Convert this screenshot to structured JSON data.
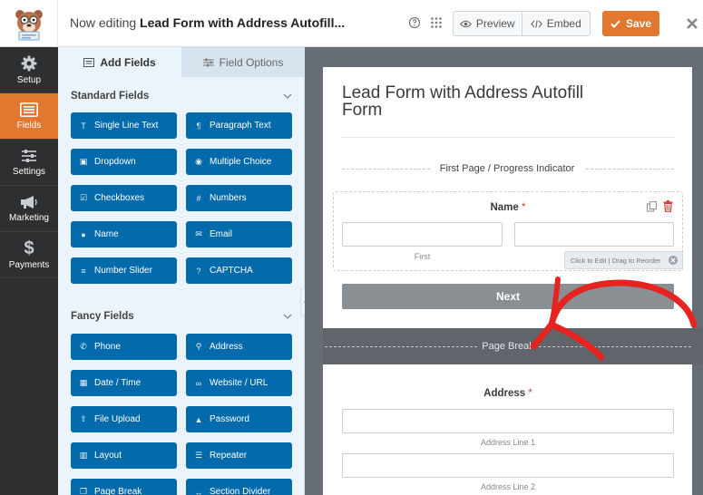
{
  "header": {
    "editing_prefix": "Now editing ",
    "editing_form_name": "Lead Form with Address Autofill...",
    "preview_label": "Preview",
    "embed_label": "Embed",
    "save_label": "Save",
    "icons": [
      "help-icon",
      "grid-icon",
      "eye-icon",
      "code-icon",
      "check-icon",
      "close-icon"
    ]
  },
  "sidebar": {
    "items": [
      {
        "label": "Setup",
        "icon": "gear-icon"
      },
      {
        "label": "Fields",
        "icon": "fields-list-icon",
        "active": true
      },
      {
        "label": "Settings",
        "icon": "sliders-icon"
      },
      {
        "label": "Marketing",
        "icon": "megaphone-icon"
      },
      {
        "label": "Payments",
        "icon": "dollar-icon"
      }
    ]
  },
  "panel": {
    "tabs": [
      {
        "label": "Add Fields",
        "icon": "list-icon",
        "active": true
      },
      {
        "label": "Field Options",
        "icon": "sliders-icon",
        "active": false
      }
    ],
    "standard_title": "Standard Fields",
    "standard_fields": [
      {
        "label": "Single Line Text",
        "icon": "text-icon"
      },
      {
        "label": "Paragraph Text",
        "icon": "paragraph-icon"
      },
      {
        "label": "Dropdown",
        "icon": "dropdown-icon"
      },
      {
        "label": "Multiple Choice",
        "icon": "radio-icon"
      },
      {
        "label": "Checkboxes",
        "icon": "checkbox-icon"
      },
      {
        "label": "Numbers",
        "icon": "hash-icon"
      },
      {
        "label": "Name",
        "icon": "user-icon"
      },
      {
        "label": "Email",
        "icon": "envelope-icon"
      },
      {
        "label": "Number Slider",
        "icon": "slider-icon"
      },
      {
        "label": "CAPTCHA",
        "icon": "question-icon"
      }
    ],
    "fancy_title": "Fancy Fields",
    "fancy_fields": [
      {
        "label": "Phone",
        "icon": "phone-icon"
      },
      {
        "label": "Address",
        "icon": "map-pin-icon"
      },
      {
        "label": "Date / Time",
        "icon": "calendar-icon"
      },
      {
        "label": "Website / URL",
        "icon": "link-icon"
      },
      {
        "label": "File Upload",
        "icon": "upload-icon"
      },
      {
        "label": "Password",
        "icon": "lock-icon"
      },
      {
        "label": "Layout",
        "icon": "columns-icon"
      },
      {
        "label": "Repeater",
        "icon": "repeater-icon"
      },
      {
        "label": "Page Break",
        "icon": "copy-icon"
      },
      {
        "label": "Section Divider",
        "icon": "arrows-icon"
      }
    ]
  },
  "form": {
    "title": "Lead Form with Address Autofill Form",
    "progress_label": "First Page / Progress Indicator",
    "name_label": "Name",
    "required_mark": "*",
    "first_sublabel": "First",
    "tooltip": "Click to Edit | Drag to Reorder",
    "next_label": "Next",
    "page_break_label": "Page Break",
    "address_label": "Address",
    "address_line1": "Address Line 1",
    "address_line2": "Address Line 2"
  },
  "colors": {
    "accent_orange": "#e27730",
    "field_button_blue": "#036aab",
    "nav_dark": "#2d2f31",
    "annotation_red": "#e5231f"
  }
}
